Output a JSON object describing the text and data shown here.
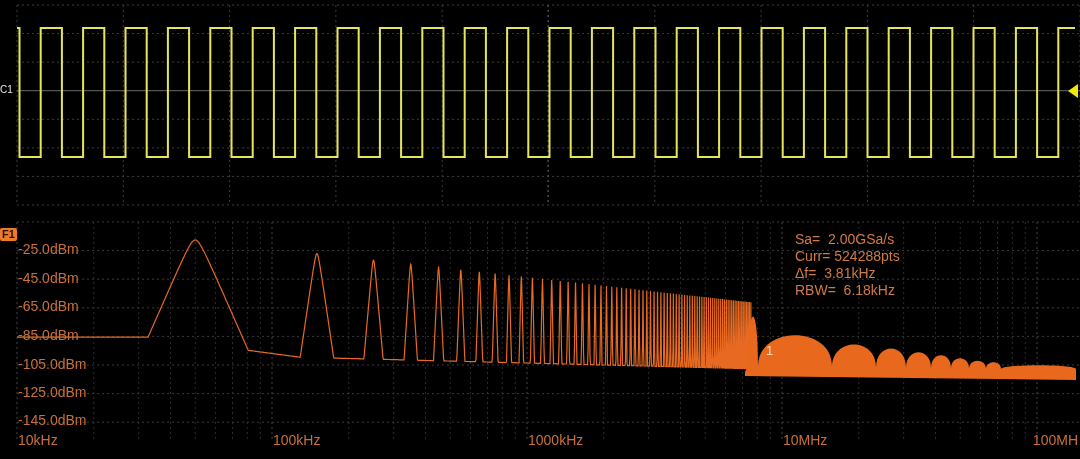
{
  "time_panel": {
    "channel_label": "C1"
  },
  "fft_panel": {
    "math_badge": "F1",
    "y_labels": [
      "-25.0dBm",
      "-45.0dBm",
      "-65.0dBm",
      "-85.0dBm",
      "-105.0dBm",
      "-125.0dBm",
      "-145.0dBm"
    ],
    "x_labels": [
      "10kHz",
      "100kHz",
      "1000kHz",
      "10MHz",
      "100MH"
    ],
    "readouts": [
      "Sa=  2.00GSa/s",
      "Curr= 524288pts",
      "Δf=  3.81kHz",
      "RBW=  6.18kHz"
    ],
    "marker_label": "1"
  }
}
